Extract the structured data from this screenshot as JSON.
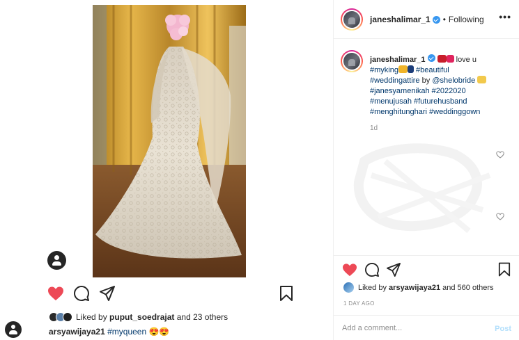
{
  "background_post": {
    "liked_by_prefix": "Liked by",
    "liked_by_user": "puput_soedrajat",
    "liked_by_suffix": "and 23 others",
    "caption_user": "arsyawijaya21",
    "caption_tag": "#myqueen",
    "caption_emojis": "😍😍"
  },
  "header": {
    "username": "janeshalimar_1",
    "separator": "•",
    "following_label": "Following",
    "more_label": "•••"
  },
  "caption": {
    "username": "janeshalimar_1",
    "line1_text": "love u",
    "line2_tag": "#myking",
    "line2_tag2": "#beautiful",
    "line3_tag": "#weddingattire",
    "line3_text": "by",
    "line3_mention": "@shelobride",
    "line4": "#janesyamenikah #2022020",
    "line5": "#menujusah #futurehusband",
    "line6": "#menghitunghari #weddinggown",
    "time": "1d"
  },
  "actions": {
    "liked_by_prefix": "Liked by",
    "liked_by_user": "arsyawijaya21",
    "liked_by_suffix": "and 560 others",
    "date": "1 DAY AGO"
  },
  "comment_box": {
    "placeholder": "Add a comment...",
    "post_label": "Post"
  },
  "colors": {
    "like_red": "#ed4956",
    "link_blue": "#00376b",
    "verified_blue": "#3897f0",
    "post_disabled": "#b2dffc"
  }
}
